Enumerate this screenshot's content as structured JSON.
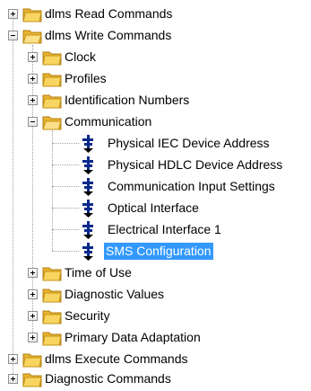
{
  "tree": {
    "dlms_read": "dlms Read Commands",
    "dlms_write": "dlms Write Commands",
    "clock": "Clock",
    "profiles": "Profiles",
    "identification": "Identification Numbers",
    "communication": "Communication",
    "comm_items": [
      "Physical IEC Device Address",
      "Physical HDLC Device Address",
      "Communication Input Settings",
      "Optical Interface",
      "Electrical Interface 1",
      "SMS Configuration"
    ],
    "time_of_use": "Time of Use",
    "diagnostic_values": "Diagnostic Values",
    "security": "Security",
    "primary_data": "Primary Data Adaptation",
    "dlms_execute": "dlms Execute Commands",
    "diagnostic_commands": "Diagnostic Commands",
    "selected_item": "SMS Configuration"
  },
  "colors": {
    "selection": "#3399ff",
    "folder": "#f5c445",
    "node_icon": "#0a2a8c"
  }
}
